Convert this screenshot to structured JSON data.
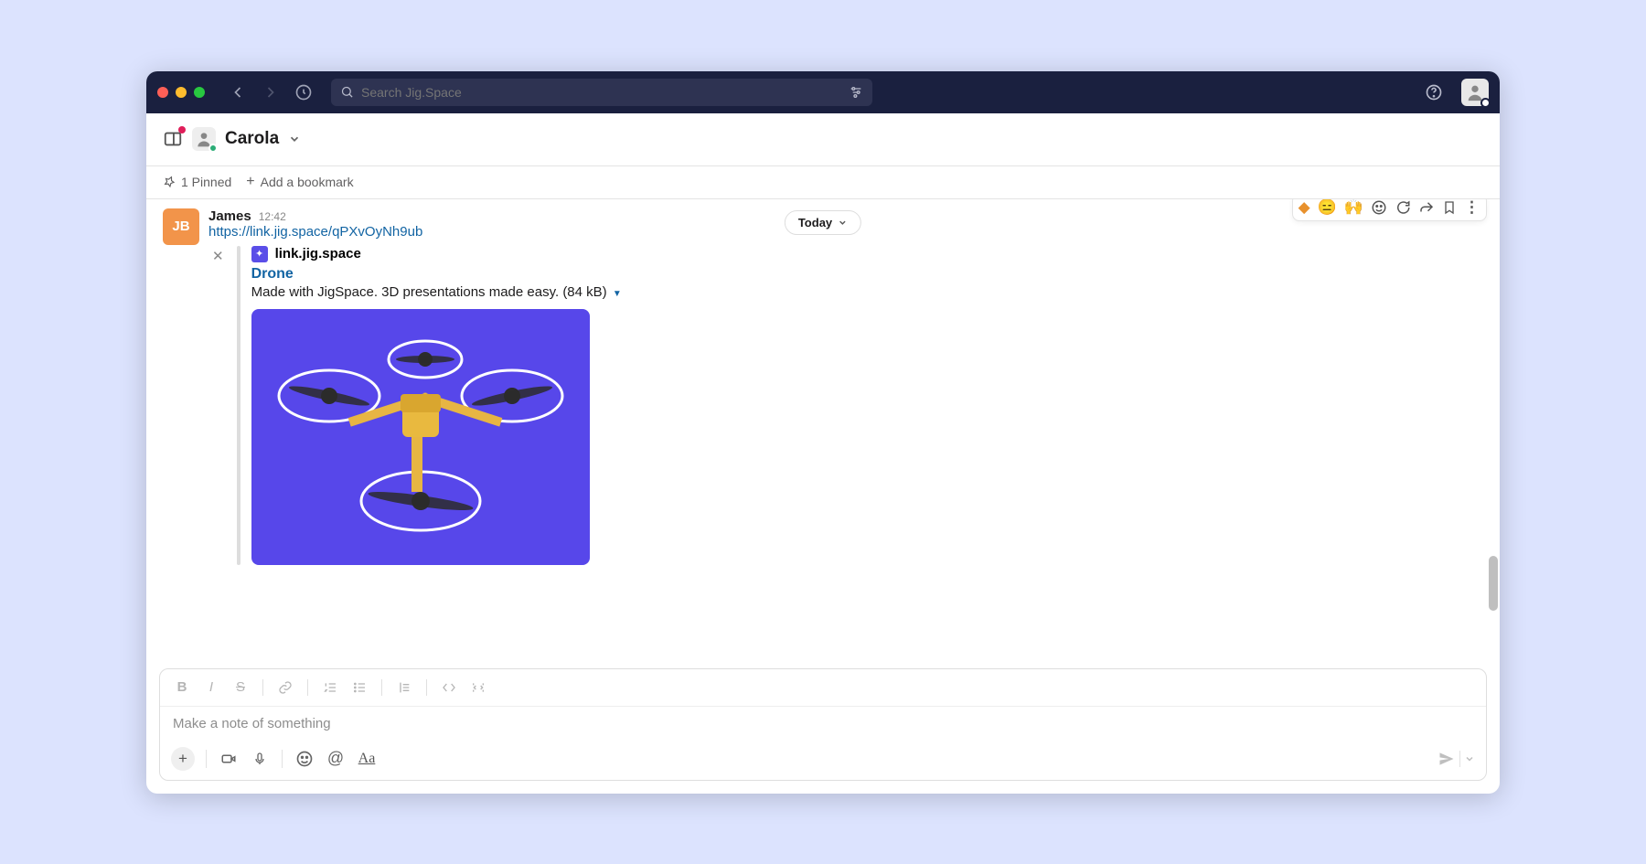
{
  "search": {
    "placeholder": "Search Jig.Space"
  },
  "channel": {
    "name": "Carola"
  },
  "pinbar": {
    "pinned": "1 Pinned",
    "addBookmark": "Add a bookmark"
  },
  "divider": {
    "label": "Today"
  },
  "message": {
    "avatarInitials": "JB",
    "sender": "James",
    "time": "12:42",
    "url": "https://link.jig.space/qPXvOyNh9ub",
    "unfurl": {
      "site": "link.jig.space",
      "title": "Drone",
      "description": "Made with JigSpace. 3D presentations made easy. (84 kB)"
    }
  },
  "composer": {
    "placeholder": "Make a note of something"
  }
}
